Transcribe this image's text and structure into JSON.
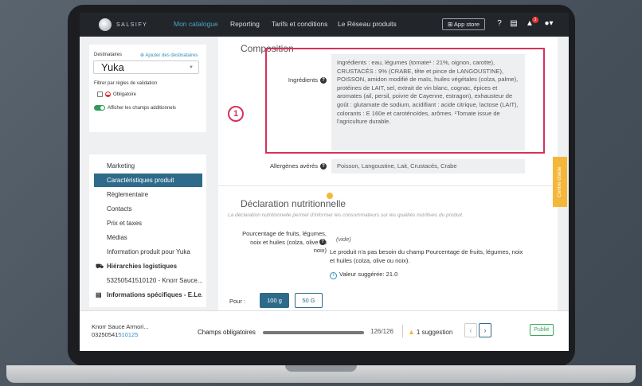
{
  "app": {
    "logo_text": "SALSIFY"
  },
  "nav": {
    "items": [
      "Mon catalogue",
      "Reporting",
      "Tarifs et conditions",
      "Le Réseau produits"
    ],
    "app_store": "⊞ App store",
    "notification_count": "1"
  },
  "filters": {
    "destinataires_label": "Destinataires",
    "add_label": "Ajouter des destinataires",
    "selected": "Yuka",
    "rules_label": "Filtrer par règles de validation",
    "obligatoire": "Obligatoire",
    "show_additional": "Afficher les champs additionnels"
  },
  "sidebar": {
    "items": [
      {
        "label": "Marketing"
      },
      {
        "label": "Caractéristiques produit"
      },
      {
        "label": "Règlementaire"
      },
      {
        "label": "Contacts"
      },
      {
        "label": "Prix et taxes"
      },
      {
        "label": "Médias"
      },
      {
        "label": "Information produit pour Yuka"
      },
      {
        "label": "Hiérarchies logistiques"
      },
      {
        "label": "53250541510120 - Knorr Sauce..."
      },
      {
        "label": "Informations spécifiques - E.Le..."
      }
    ]
  },
  "composition": {
    "title": "Composition",
    "ingredients_label": "Ingrédients",
    "ingredients_text": "Ingrédients : eau, légumes (tomate¹ : 21%, oignon, carotte), CRUSTACÉS : 9% (CRABE, tête et pince de LANGOUSTINE), POISSON, amidon modifié de maïs, huiles végétales (colza, palme), protéines de LAIT, sel, extrait de vin blanc, cognac, épices et aromates (ail, persil, poivre de Cayenne, estragon), exhausteur de goût : glutamate de sodium, acidifiant : acide citrique, lactose (LAIT), colorants : E 160e et caroténoïdes, arômes. ¹Tomate issue de l'agriculture durable.",
    "allergens_label": "Allergènes avérés",
    "allergens_text": "Poisson, Langoustine, Lait, Crustacés, Crabe",
    "callout": "1"
  },
  "nutrition": {
    "title": "Déclaration nutritionnelle",
    "subtitle": "La déclaration nutritionnelle permet d'informer les consommateurs sur les qualités nutritives du produit.",
    "fruit_label": "Pourcentage de fruits, légumes, noix et huiles (colza, olive ou noix)",
    "fruit_value": "(vide)",
    "fruit_message": "Le produit n'a pas besoin du champ Pourcentage de fruits, légumes, noix et huiles (colza, olive ou noix).",
    "suggested": "Valeur suggérée: 21.0",
    "pour_label": "Pour :",
    "portions": [
      "100 g",
      "50 G"
    ],
    "selected_portion": "100 g"
  },
  "help_tab": "Centre d'aide",
  "footer": {
    "product_name": "Knorr Sauce Armori...",
    "product_code_prefix": "03250541",
    "product_code_highlight": "510125",
    "champs_label": "Champs obligatoires",
    "progress": 1.0,
    "count": "126/126",
    "suggestions": "1 suggestion",
    "status": "Publié"
  },
  "colors": {
    "accent": "#2e6a8a",
    "highlight_frame": "#d6315c",
    "help_tab": "#f5b73a",
    "published": "#39a85b"
  }
}
